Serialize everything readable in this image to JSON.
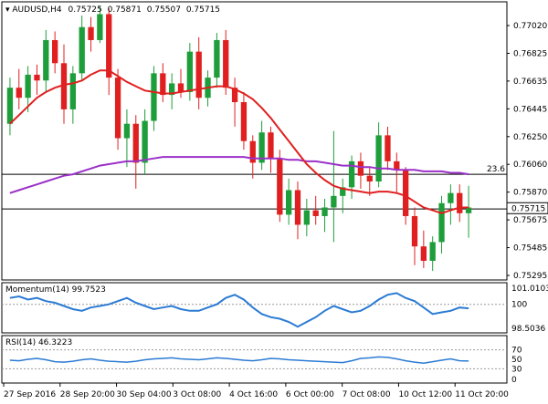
{
  "header": {
    "symbol": "AUDUSD,H4",
    "open": "0.75725",
    "high": "0.75871",
    "low": "0.75507",
    "close": "0.75715"
  },
  "price_axis": {
    "labels": [
      "0.77020",
      "0.76825",
      "0.76635",
      "0.76445",
      "0.76250",
      "0.76060",
      "0.75870",
      "0.75675",
      "0.75485",
      "0.75295"
    ],
    "current_price": "0.75715"
  },
  "time_axis": {
    "labels": [
      "27 Sep 2016",
      "28 Sep 20:00",
      "30 Sep 04:00",
      "3 Oct 08:00",
      "4 Oct 16:00",
      "6 Oct 00:00",
      "7 Oct 08:00",
      "10 Oct 12:00",
      "11 Oct 20:00"
    ]
  },
  "horizontal_lines": [
    {
      "price": 0.7595,
      "label": "23.6"
    },
    {
      "price": 0.7571,
      "label": ""
    }
  ],
  "momentum": {
    "title": "Momentum(14) 99.7523",
    "ticks": [
      "101.0103",
      "100",
      "98.5036"
    ]
  },
  "rsi": {
    "title": "RSI(14) 46.3223",
    "ticks": [
      "70",
      "50",
      "30",
      "0"
    ]
  },
  "colors": {
    "bull": "#1e9e3a",
    "bear": "#e02020",
    "sma_fast": "#e02020",
    "sma_slow": "#9b30c8",
    "indicator": "#2b7bd4",
    "grid": "#000000",
    "current_price_box": "#ffffff"
  },
  "chart_data": {
    "type": "candlestick",
    "title": "AUDUSD,H4",
    "ylim": [
      0.7523,
      0.7712
    ],
    "candles": [
      [
        0.763,
        0.7662,
        0.7622,
        0.7655
      ],
      [
        0.7655,
        0.7668,
        0.764,
        0.7648
      ],
      [
        0.7648,
        0.767,
        0.7638,
        0.7664
      ],
      [
        0.7664,
        0.7671,
        0.765,
        0.766
      ],
      [
        0.766,
        0.7695,
        0.7652,
        0.7688
      ],
      [
        0.7688,
        0.7694,
        0.7665,
        0.7672
      ],
      [
        0.7672,
        0.7685,
        0.763,
        0.764
      ],
      [
        0.764,
        0.767,
        0.763,
        0.7665
      ],
      [
        0.7665,
        0.7705,
        0.766,
        0.7697
      ],
      [
        0.7697,
        0.7704,
        0.768,
        0.7688
      ],
      [
        0.7688,
        0.7712,
        0.7686,
        0.7706
      ],
      [
        0.7706,
        0.771,
        0.765,
        0.7662
      ],
      [
        0.7662,
        0.7668,
        0.7612,
        0.762
      ],
      [
        0.762,
        0.764,
        0.76,
        0.763
      ],
      [
        0.763,
        0.7636,
        0.7585,
        0.7603
      ],
      [
        0.7603,
        0.764,
        0.7595,
        0.7632
      ],
      [
        0.7632,
        0.767,
        0.7625,
        0.7665
      ],
      [
        0.7665,
        0.7672,
        0.7645,
        0.765
      ],
      [
        0.765,
        0.7665,
        0.764,
        0.7658
      ],
      [
        0.7658,
        0.7668,
        0.7648,
        0.7652
      ],
      [
        0.7652,
        0.7686,
        0.7646,
        0.768
      ],
      [
        0.768,
        0.769,
        0.764,
        0.7648
      ],
      [
        0.7648,
        0.7667,
        0.7642,
        0.7662
      ],
      [
        0.7662,
        0.7693,
        0.7655,
        0.7688
      ],
      [
        0.7688,
        0.7695,
        0.765,
        0.7655
      ],
      [
        0.7655,
        0.7662,
        0.7628,
        0.7645
      ],
      [
        0.7645,
        0.7652,
        0.7612,
        0.7618
      ],
      [
        0.7618,
        0.7622,
        0.7592,
        0.7603
      ],
      [
        0.7603,
        0.7632,
        0.7598,
        0.7624
      ],
      [
        0.7624,
        0.7628,
        0.7596,
        0.7606
      ],
      [
        0.7606,
        0.7612,
        0.7562,
        0.7567
      ],
      [
        0.7567,
        0.7592,
        0.756,
        0.7584
      ],
      [
        0.7584,
        0.759,
        0.755,
        0.756
      ],
      [
        0.756,
        0.7578,
        0.7552,
        0.757
      ],
      [
        0.757,
        0.758,
        0.756,
        0.7566
      ],
      [
        0.7566,
        0.7578,
        0.7555,
        0.7572
      ],
      [
        0.7572,
        0.7625,
        0.7548,
        0.758
      ],
      [
        0.758,
        0.7592,
        0.7568,
        0.7586
      ],
      [
        0.7586,
        0.7608,
        0.7578,
        0.7604
      ],
      [
        0.7604,
        0.761,
        0.7585,
        0.7594
      ],
      [
        0.7594,
        0.76,
        0.758,
        0.759
      ],
      [
        0.759,
        0.7631,
        0.7586,
        0.7622
      ],
      [
        0.7622,
        0.7628,
        0.7598,
        0.7604
      ],
      [
        0.7604,
        0.761,
        0.7582,
        0.7598
      ],
      [
        0.7598,
        0.76,
        0.756,
        0.7566
      ],
      [
        0.7566,
        0.7572,
        0.7532,
        0.7545
      ],
      [
        0.7545,
        0.7556,
        0.753,
        0.7535
      ],
      [
        0.7535,
        0.7552,
        0.7528,
        0.7548
      ],
      [
        0.7548,
        0.758,
        0.754,
        0.7575
      ],
      [
        0.7575,
        0.7588,
        0.756,
        0.7582
      ],
      [
        0.7582,
        0.7588,
        0.7562,
        0.7568
      ],
      [
        0.7568,
        0.7587,
        0.7551,
        0.7572
      ]
    ],
    "sma_fast": [
      0.763,
      0.7636,
      0.7642,
      0.7648,
      0.7652,
      0.7655,
      0.7657,
      0.7658,
      0.766,
      0.7664,
      0.7667,
      0.7667,
      0.7663,
      0.7659,
      0.7656,
      0.7653,
      0.7652,
      0.7651,
      0.7651,
      0.7652,
      0.7653,
      0.7654,
      0.7655,
      0.7656,
      0.7656,
      0.7654,
      0.7651,
      0.7647,
      0.7641,
      0.7634,
      0.7626,
      0.7618,
      0.761,
      0.7602,
      0.7596,
      0.7591,
      0.7587,
      0.7585,
      0.7584,
      0.7583,
      0.7582,
      0.7583,
      0.7583,
      0.7582,
      0.758,
      0.7576,
      0.7572,
      0.757,
      0.7568,
      0.757,
      0.7572,
      0.7572
    ],
    "sma_slow": [
      0.7582,
      0.7584,
      0.7586,
      0.7588,
      0.759,
      0.7592,
      0.7594,
      0.7595,
      0.7597,
      0.7599,
      0.7601,
      0.7602,
      0.7603,
      0.7604,
      0.7604,
      0.7605,
      0.7606,
      0.7607,
      0.7607,
      0.7607,
      0.7607,
      0.7607,
      0.7607,
      0.7607,
      0.7607,
      0.7607,
      0.7607,
      0.7606,
      0.7606,
      0.7606,
      0.7606,
      0.7605,
      0.7605,
      0.7604,
      0.7604,
      0.7603,
      0.7602,
      0.7601,
      0.7601,
      0.76,
      0.76,
      0.7599,
      0.7599,
      0.7598,
      0.7598,
      0.7598,
      0.7597,
      0.7597,
      0.7597,
      0.7596,
      0.7596,
      0.7595
    ],
    "momentum_range": [
      98.5036,
      101.0103
    ],
    "momentum": [
      100.4,
      100.5,
      100.3,
      100.4,
      100.2,
      100.1,
      99.9,
      99.7,
      99.6,
      99.8,
      99.9,
      100.0,
      100.2,
      100.4,
      100.1,
      99.9,
      99.7,
      99.8,
      99.9,
      99.7,
      99.6,
      99.6,
      99.8,
      100.0,
      100.4,
      100.6,
      100.3,
      99.8,
      99.4,
      99.2,
      99.1,
      98.9,
      98.6,
      98.9,
      99.2,
      99.6,
      99.9,
      99.7,
      99.5,
      99.6,
      99.9,
      100.3,
      100.6,
      100.7,
      100.4,
      100.2,
      99.8,
      99.4,
      99.5,
      99.6,
      99.8,
      99.75
    ],
    "rsi_range": [
      0,
      100
    ],
    "rsi": [
      48,
      47,
      50,
      52,
      49,
      45,
      44,
      46,
      49,
      51,
      48,
      46,
      45,
      44,
      46,
      49,
      51,
      52,
      53,
      51,
      50,
      49,
      51,
      53,
      52,
      50,
      48,
      47,
      49,
      52,
      51,
      49,
      48,
      47,
      46,
      45,
      44,
      43,
      47,
      52,
      53,
      55,
      54,
      51,
      47,
      44,
      42,
      45,
      48,
      51,
      47,
      46.32
    ]
  }
}
